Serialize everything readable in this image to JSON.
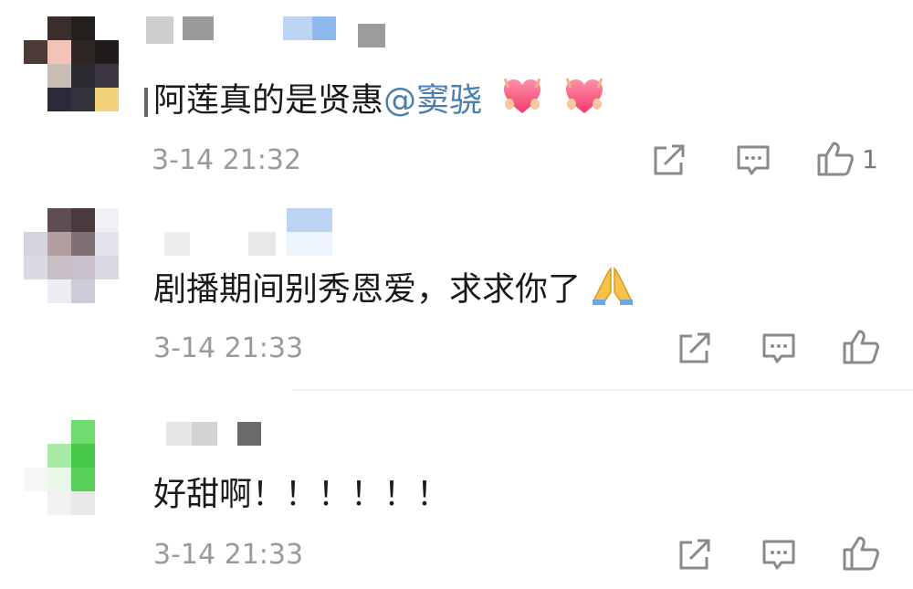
{
  "comments": [
    {
      "text": "阿莲真的是贤惠",
      "mention": "@窦骁",
      "emojis": [
        "heart-emoji",
        "heart-emoji"
      ],
      "time": "3-14 21:32",
      "like_count": "1",
      "avatar_colors": [
        "#ffffff",
        "#3a2e2b",
        "#23201e",
        "#ffffff",
        "#4b3a36",
        "#f2c4b5",
        "#2e2624",
        "#1f1b1a",
        "#ffffff",
        "#c9bdb8",
        "#2a2a30",
        "#3a3540",
        "#ffffff",
        "#2a2a38",
        "#33333d",
        "#f1d27a"
      ],
      "name_blocks": [
        "#cfcfcf",
        "#9b9b9b",
        "#7b7b7b",
        "#cdd8f0",
        "#8fb8ec"
      ]
    },
    {
      "text": "剧播期间别秀恩爱，求求你了",
      "emojis": [
        "folded-hands-emoji"
      ],
      "time": "3-14 21:33",
      "like_count": "",
      "avatar_colors": [
        "#ffffff",
        "#5e4e52",
        "#4a3a3e",
        "#f0f0f5",
        "#d7d3dc",
        "#b09ea0",
        "#7d6f72",
        "#e4e2ea",
        "#dcd9e3",
        "#c9c0c6",
        "#c8c1cc",
        "#d9d8e2",
        "#ffffff",
        "#ececf2",
        "#cfccd9",
        "#ffffff"
      ],
      "name_blocks": [
        "#f2f2f2",
        "#e6e6e6",
        "#bcd3f4",
        "#d9e6f7"
      ]
    },
    {
      "text": "好甜啊！！！！！！",
      "emojis": [],
      "time": "3-14 21:33",
      "like_count": "",
      "avatar_colors": [
        "#ffffff",
        "#ffffff",
        "#6fdc6f",
        "#ffffff",
        "#ffffff",
        "#a8eba8",
        "#49c94a",
        "#ffffff",
        "#f6f6f6",
        "#e9f8e9",
        "#59d05a",
        "#ffffff",
        "#ffffff",
        "#f2f2f2",
        "#e9e9e9",
        "#ffffff"
      ],
      "name_blocks": [
        "#e0e0e0",
        "#cfcfcf",
        "#6a6a6a"
      ]
    }
  ],
  "icons": {
    "share": "share-icon",
    "comment": "comment-icon",
    "like": "thumbs-up-icon"
  },
  "colors": {
    "mention": "#4a7fb0",
    "time": "#9a9a9a",
    "icon": "#8a8a8a"
  }
}
